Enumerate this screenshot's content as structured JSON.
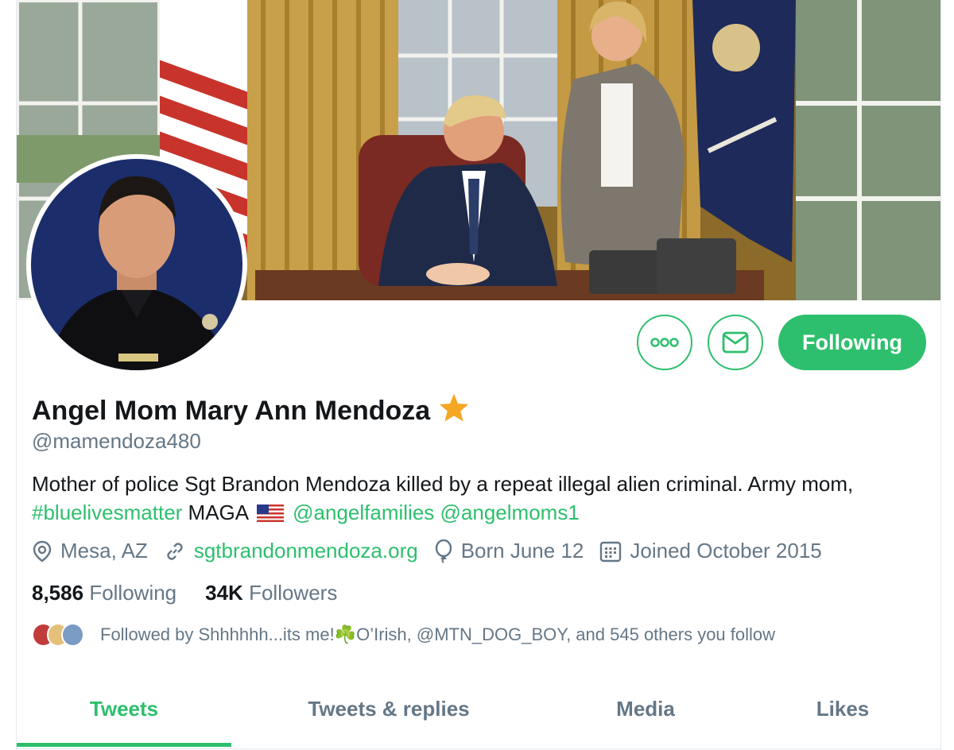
{
  "profile": {
    "display_name": "Angel Mom Mary Ann Mendoza",
    "handle": "@mamendoza480",
    "bio": {
      "text_1": "Mother of police Sgt Brandon Mendoza killed by a repeat illegal alien criminal. Army mom,",
      "hashtag": "#bluelivesmatter",
      "text_2": "MAGA",
      "mention_1": "@angelfamilies",
      "mention_2": "@angelmoms1"
    },
    "location": "Mesa, AZ",
    "website": "sgtbrandonmendoza.org",
    "birthday": "Born June 12",
    "joined": "Joined October 2015",
    "following_count": "8,586",
    "following_label": "Following",
    "followers_count": "34K",
    "followers_label": "Followers",
    "followed_by": "Followed by Shhhhhh...its me!☘️O’Irish, @MTN_DOG_BOY, and 545 others you follow"
  },
  "actions": {
    "more_icon": "more-dots-icon",
    "message_icon": "envelope-icon",
    "follow_label": "Following"
  },
  "tabs": [
    {
      "label": "Tweets",
      "active": true
    },
    {
      "label": "Tweets & replies",
      "active": false
    },
    {
      "label": "Media",
      "active": false
    },
    {
      "label": "Likes",
      "active": false
    }
  ],
  "colors": {
    "accent": "#2dbf6d",
    "text": "#14171a",
    "muted": "#657786",
    "star": "#f5a623"
  },
  "icons": {
    "verified_badge": "star-icon",
    "location": "location-pin-icon",
    "website": "link-icon",
    "birthday": "balloon-icon",
    "joined": "calendar-icon",
    "flag": "us-flag-emoji"
  }
}
